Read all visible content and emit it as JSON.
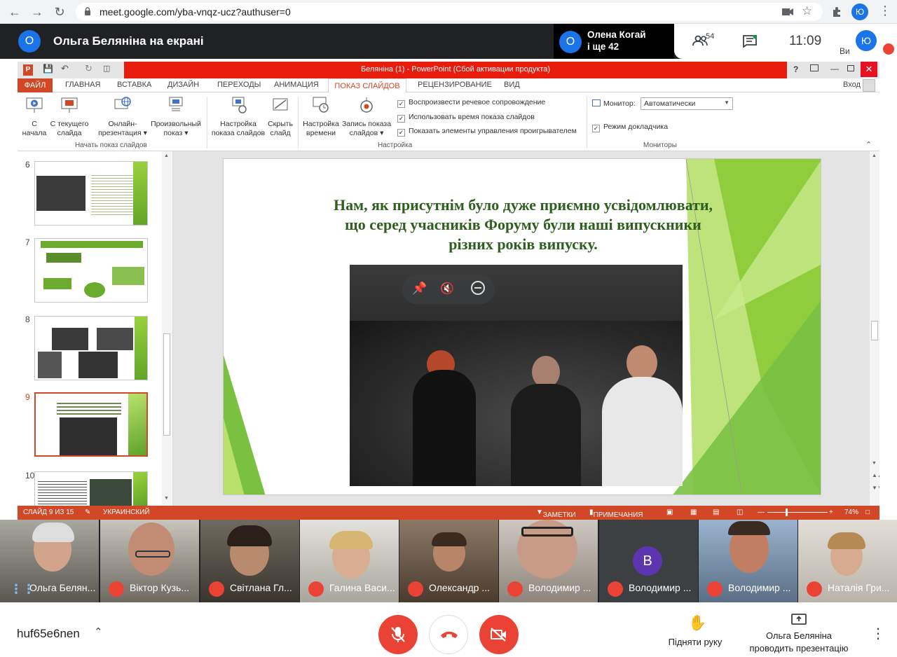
{
  "browser": {
    "url": "meet.google.com/yba-vnqz-ucz?authuser=0",
    "profile_initial": "Ю"
  },
  "meet_header": {
    "presenter_initial": "O",
    "presenter_title": "Ольга Беляніна на екрані",
    "speaker_initial": "O",
    "speaker_name": "Олена Когай",
    "speaker_more": "і ще 42",
    "participants_count": "54",
    "time": "11:09",
    "self_label": "Ви",
    "self_initial": "Ю"
  },
  "powerpoint": {
    "window_title": "Беляніна (1) - PowerPoint (Сбой активации продукта)",
    "tabs": [
      "ФАЙЛ",
      "ГЛАВНАЯ",
      "ВСТАВКА",
      "ДИЗАЙН",
      "ПЕРЕХОДЫ",
      "АНИМАЦИЯ",
      "ПОКАЗ СЛАЙДОВ",
      "РЕЦЕНЗИРОВАНИЕ",
      "ВИД"
    ],
    "login": "Вход",
    "ribbon": {
      "from_start": [
        "С",
        "начала"
      ],
      "from_current": [
        "С текущего",
        "слайда"
      ],
      "online": [
        "Онлайн-",
        "презентация ▾"
      ],
      "custom": [
        "Произвольный",
        "показ ▾"
      ],
      "setup": [
        "Настройка",
        "показа слайдов"
      ],
      "hide": [
        "Скрыть",
        "слайд"
      ],
      "timing": [
        "Настройка",
        "времени"
      ],
      "record": [
        "Запись показа",
        "слайдов ▾"
      ],
      "check_narration": "Воспроизвести речевое сопровождение",
      "check_timings": "Использовать время показа слайдов",
      "check_controls": "Показать элементы управления проигрывателем",
      "monitor_label": "Монитор:",
      "monitor_value": "Автоматически",
      "presenter_view": "Режим докладчика",
      "group_start": "Начать показ слайдов",
      "group_setup": "Настройка",
      "group_monitors": "Мониторы"
    },
    "thumb_numbers": [
      "6",
      "7",
      "8",
      "9",
      "10"
    ],
    "slide_text": "Нам, як присутнім було дуже приємно усвідомлювати, що серед учасників  Форуму були наші випускники різних років випуску.",
    "status": {
      "slide_pos": "СЛАЙД 9 ИЗ 15",
      "language": "УКРАИНСКИЙ",
      "notes": "ЗАМЕТКИ",
      "comments": "ПРИМЕЧАНИЯ",
      "zoom": "74%"
    }
  },
  "participants": [
    {
      "name": "Ольга Белян...",
      "speaking": true
    },
    {
      "name": "Віктор Кузь...",
      "speaking": false
    },
    {
      "name": "Світлана Гл...",
      "speaking": false
    },
    {
      "name": "Галина Васи...",
      "speaking": false
    },
    {
      "name": "Олександр ...",
      "speaking": false
    },
    {
      "name": "Володимир ...",
      "speaking": false
    },
    {
      "name": "Володимир ...",
      "speaking": false,
      "avatar": "В"
    },
    {
      "name": "Володимир ...",
      "speaking": false
    },
    {
      "name": "Наталія Гри...",
      "speaking": false
    }
  ],
  "bottom": {
    "meeting_code": "huf65e6nen",
    "raise_hand": "Підняти руку",
    "presenting_line1": "Ольга Беляніна",
    "presenting_line2": "проводить презентацію"
  },
  "colors": {
    "ppt_accent": "#d24726",
    "meet_red": "#ea4335",
    "meet_blue": "#1a73e8",
    "slide_green": "#2e5f1f"
  }
}
